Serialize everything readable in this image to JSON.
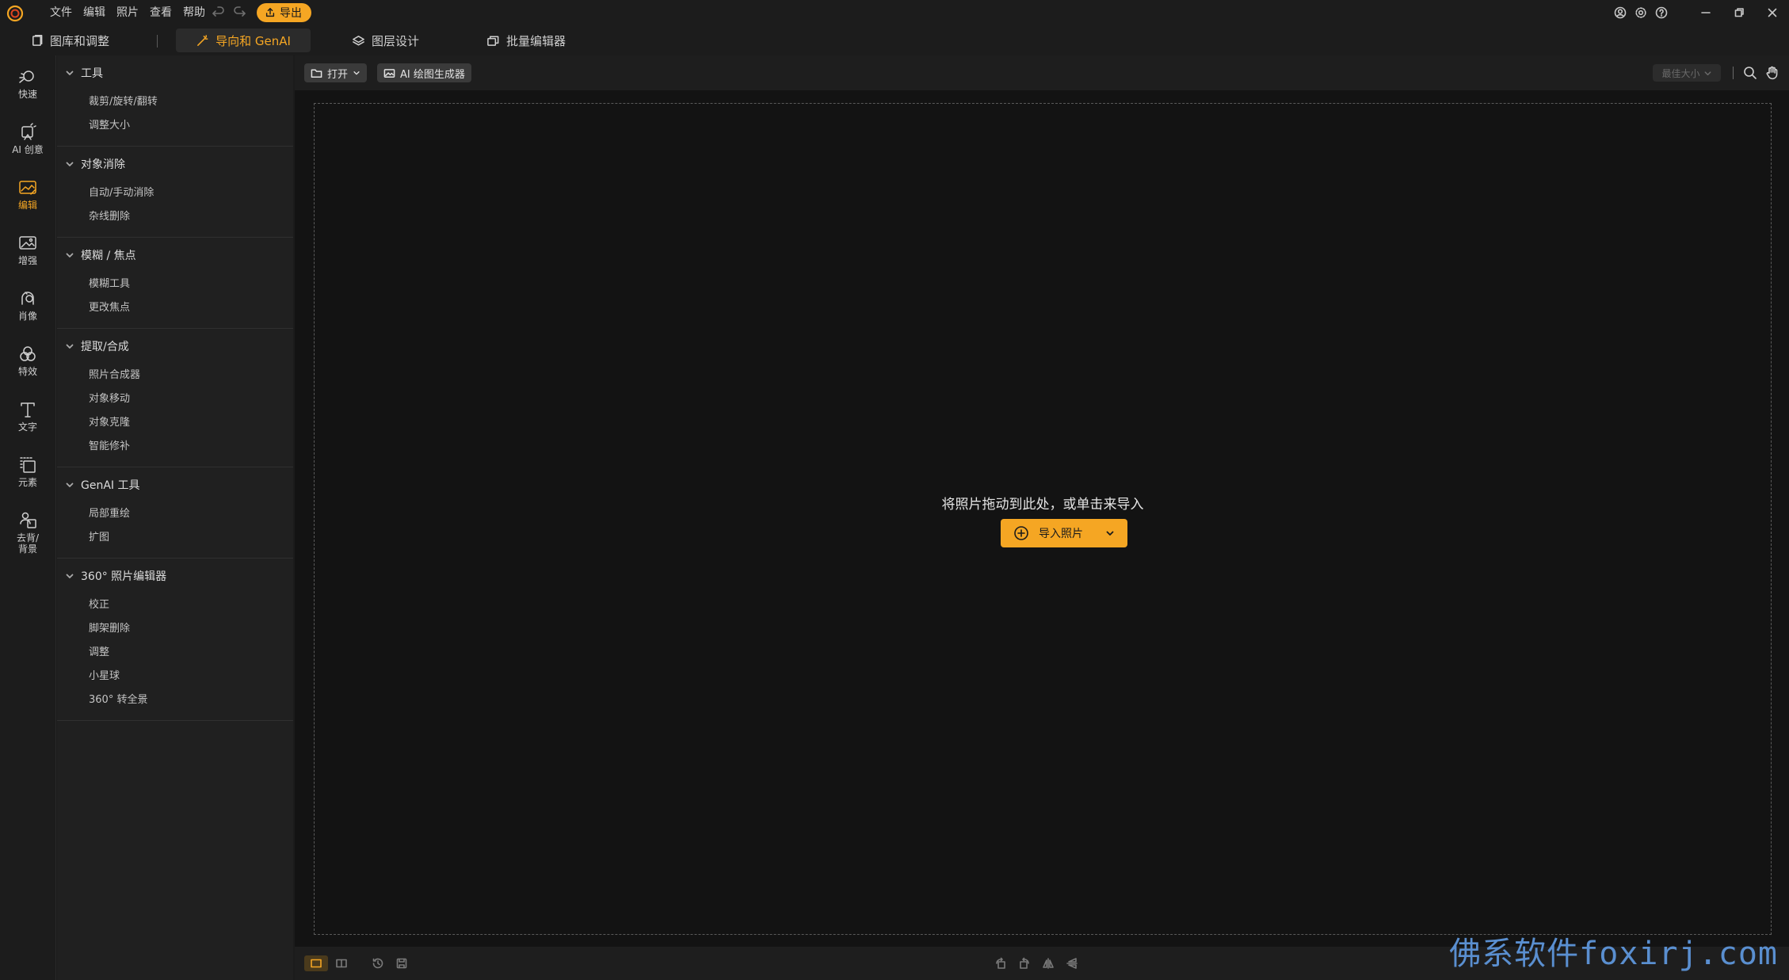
{
  "menu": [
    "文件",
    "编辑",
    "照片",
    "查看",
    "帮助"
  ],
  "export_label": "导出",
  "tabs": {
    "library": "图库和调整",
    "guided": "导向和 GenAI",
    "layers": "图层设计",
    "batch": "批量编辑器"
  },
  "rail": [
    "快速",
    "AI 创意",
    "编辑",
    "增强",
    "肖像",
    "特效",
    "文字",
    "元素",
    "去背/背景"
  ],
  "panel": {
    "sections": [
      {
        "title": "工具",
        "items": [
          "裁剪/旋转/翻转",
          "调整大小"
        ]
      },
      {
        "title": "对象消除",
        "items": [
          "自动/手动消除",
          "杂线删除"
        ]
      },
      {
        "title": "模糊 / 焦点",
        "items": [
          "模糊工具",
          "更改焦点"
        ]
      },
      {
        "title": "提取/合成",
        "items": [
          "照片合成器",
          "对象移动",
          "对象克隆",
          "智能修补"
        ]
      },
      {
        "title": "GenAI 工具",
        "items": [
          "局部重绘",
          "扩图"
        ]
      },
      {
        "title": "360° 照片编辑器",
        "items": [
          "校正",
          "脚架删除",
          "调整",
          "小星球",
          "360° 转全景"
        ]
      }
    ]
  },
  "toolbar": {
    "open_label": "打开",
    "ai_gen_label": "AI 绘图生成器",
    "fit_label": "最佳大小"
  },
  "canvas": {
    "drop_text": "将照片拖动到此处，或单击来导入",
    "import_label": "导入照片"
  },
  "watermark": "佛系软件foxirj.com",
  "colors": {
    "accent": "#f5a623",
    "background": "#1b1b1b",
    "canvas": "#131313"
  }
}
